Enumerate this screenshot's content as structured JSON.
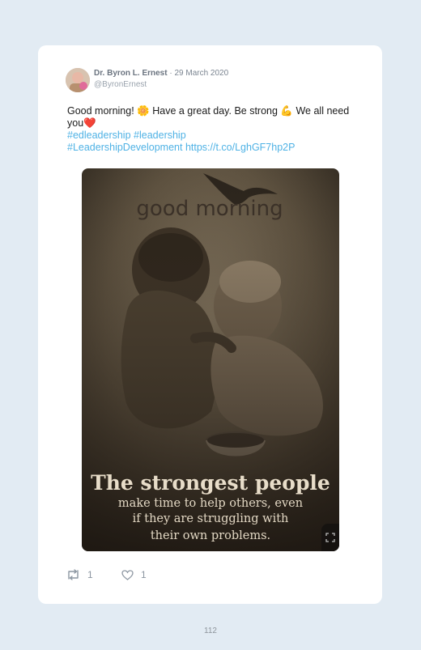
{
  "tweet": {
    "author_name": "Dr. Byron L. Ernest",
    "date": "· 29 March 2020",
    "handle": "@ByronErnest",
    "text_part1": "Good morning! ",
    "sun_emoji": "🌼",
    "text_part2": " Have a great day. Be strong ",
    "muscle_emoji": "💪",
    "text_part3": " We all need you",
    "heart_emoji": "❤️",
    "hashtag1": "#edleadership",
    "hashtag2": "#leadership",
    "hashtag3": "#LeadershipDevelopment",
    "link": "https://t.co/LghGF7hp2P"
  },
  "image": {
    "headline": "good morning",
    "caption_title": "The strongest people",
    "caption_line1": "make time to help others, even",
    "caption_line2": "if they are struggling with",
    "caption_line3": "their own problems."
  },
  "stats": {
    "retweets": "1",
    "likes": "1"
  },
  "footer": {
    "page_number": "112"
  }
}
